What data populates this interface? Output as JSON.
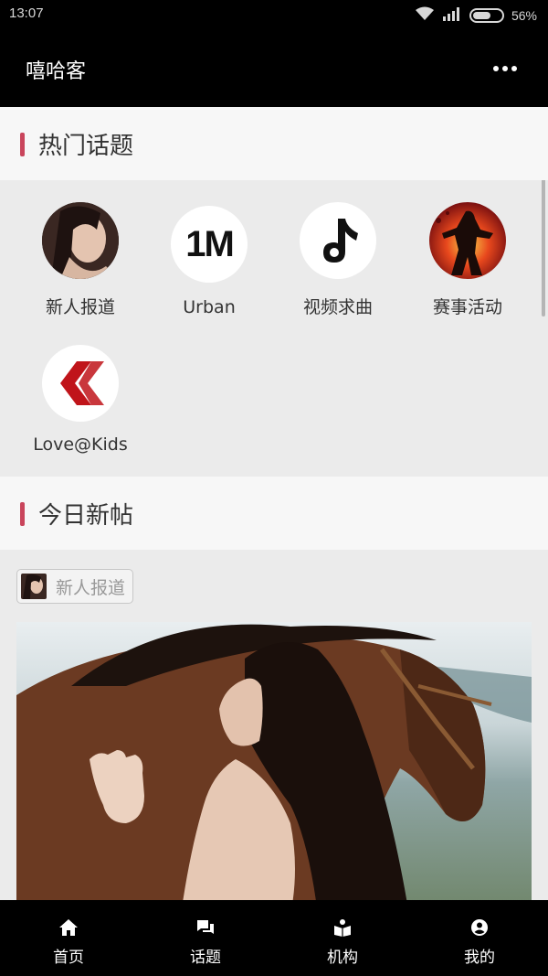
{
  "status_bar": {
    "time": "13:07",
    "battery": "56%"
  },
  "app_bar": {
    "title": "嘻哈客",
    "more_icon": "more-horizontal-icon"
  },
  "hot_topics": {
    "title": "热门话题",
    "items": [
      {
        "name": "新人报道",
        "icon": "portrait-avatar"
      },
      {
        "name": "Urban",
        "icon": "1m-logo"
      },
      {
        "name": "视频求曲",
        "icon": "music-note-logo"
      },
      {
        "name": "赛事活动",
        "icon": "event-dancer-avatar"
      },
      {
        "name": "Love@Kids",
        "icon": "red-chevron-logo"
      }
    ]
  },
  "todays_posts": {
    "title": "今日新帖",
    "post": {
      "tag": "新人报道"
    }
  },
  "bottom_nav": {
    "items": [
      {
        "label": "首页",
        "icon": "home-icon"
      },
      {
        "label": "话题",
        "icon": "chat-icon"
      },
      {
        "label": "机构",
        "icon": "book-icon"
      },
      {
        "label": "我的",
        "icon": "user-icon"
      }
    ]
  },
  "colors": {
    "accent": "#c9455c",
    "background": "#ebebeb",
    "header": "#000000"
  }
}
